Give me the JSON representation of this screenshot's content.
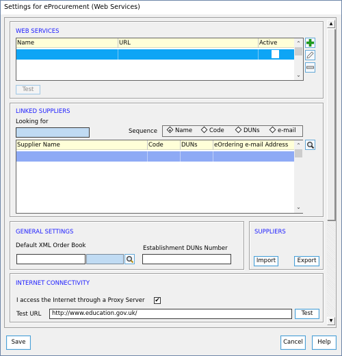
{
  "window": {
    "title": "Settings for eProcurement (Web Services)"
  },
  "web_services": {
    "title": "WEB SERVICES",
    "columns": [
      "Name",
      "URL",
      "Active"
    ],
    "rows": [
      {
        "name": "",
        "url": "",
        "active": false
      }
    ],
    "test_button": "Test",
    "add_icon": "plus-icon",
    "edit_icon": "pencil-icon",
    "remove_icon": "minus-icon",
    "selected_row_color": "#0ea5f5"
  },
  "linked_suppliers": {
    "title": "LINKED SUPPLIERS",
    "looking_for_label": "Looking for",
    "looking_for_value": "",
    "sequence_label": "Sequence",
    "sequence_options": [
      "Name",
      "Code",
      "DUNs",
      "e-mail"
    ],
    "sequence_selected": "Name",
    "columns": [
      "Supplier Name",
      "Code",
      "DUNs",
      "eOrdering e-mail Address"
    ],
    "rows": [
      {
        "supplier_name": "",
        "code": "",
        "duns": "",
        "email": ""
      }
    ],
    "search_icon": "magnifier-icon",
    "selected_row_color": "#8eaaf5"
  },
  "general_settings": {
    "title": "GENERAL SETTINGS",
    "xml_order_book_label": "Default XML Order Book",
    "xml_order_book_value": "",
    "xml_order_book_desc": "",
    "duns_label": "Establishment DUNs Number",
    "duns_value": ""
  },
  "suppliers": {
    "title": "SUPPLIERS",
    "import_button": "Import",
    "export_button": "Export"
  },
  "internet": {
    "title": "INTERNET CONNECTIVITY",
    "proxy_label": "I access the Internet through a Proxy Server",
    "proxy_checked": true,
    "proxy_check_glyph": "✔",
    "test_url_label": "Test URL",
    "test_url_value": "http://www.education.gov.uk/",
    "test_button": "Test"
  },
  "footer": {
    "save": "Save",
    "cancel": "Cancel",
    "help": "Help"
  },
  "accent": {
    "section_title": "#1a1aff",
    "grid_header": "#ffffd8"
  }
}
